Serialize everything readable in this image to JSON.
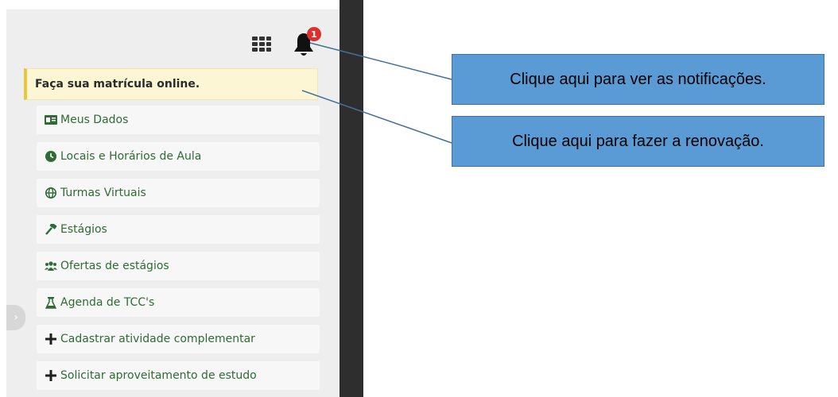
{
  "header": {
    "notification_count": "1",
    "apps_icon": "grid-icon",
    "bell_icon": "bell-icon"
  },
  "alert": {
    "text": "Faça sua matrícula online."
  },
  "menu": {
    "items": [
      {
        "label": "Meus Dados",
        "icon": "id-card-icon"
      },
      {
        "label": "Locais e Horários de Aula",
        "icon": "clock-icon"
      },
      {
        "label": "Turmas Virtuais",
        "icon": "globe-icon"
      },
      {
        "label": "Estágios",
        "icon": "gavel-icon"
      },
      {
        "label": "Ofertas de estágios",
        "icon": "users-icon"
      },
      {
        "label": "Agenda de TCC's",
        "icon": "flask-icon"
      },
      {
        "label": "Cadastrar atividade complementar",
        "icon": "plus-icon"
      },
      {
        "label": "Solicitar aproveitamento de estudo",
        "icon": "plus-icon"
      }
    ]
  },
  "callouts": {
    "notifications": "Clique aqui para ver as notificações.",
    "renewal": "Clique aqui para fazer a renovação."
  },
  "colors": {
    "menu_text": "#2e6b35",
    "alert_bg": "#fcf6d4",
    "callout_bg": "#5b9bd5",
    "badge": "#d9312d"
  }
}
